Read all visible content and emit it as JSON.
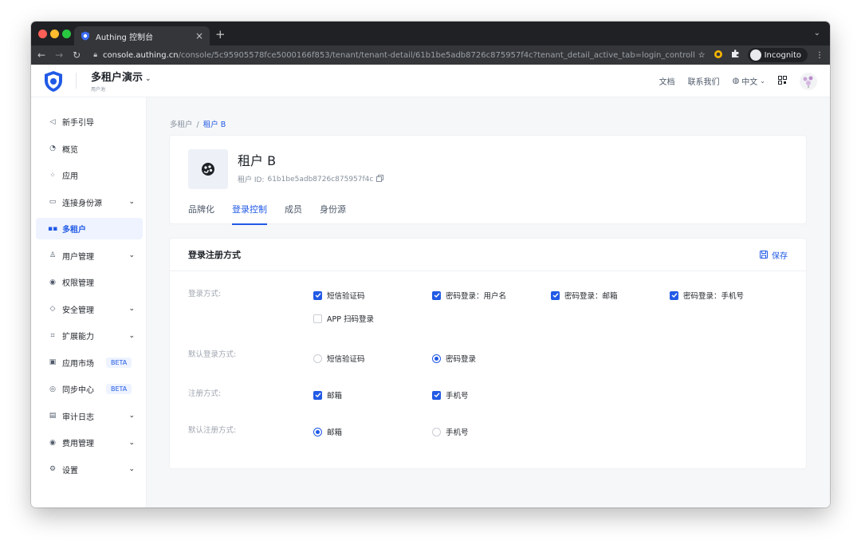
{
  "browser": {
    "tab_title": "Authing 控制台",
    "tab_close": "×",
    "new_tab": "+",
    "url_host": "console.authing.cn",
    "url_path": "/console/5c95905578fce5000166f853/tenant/tenant-detail/61b1be5adb8726c875957f4c?tenant_detail_active_tab=login_controll",
    "incognito_label": "Incognito"
  },
  "header": {
    "org_name": "多租户演示",
    "org_sub": "用户池",
    "links": [
      "文档",
      "联系我们"
    ],
    "language": "中文"
  },
  "sidebar": {
    "items": [
      {
        "label": "新手引导",
        "icon": "send-icon"
      },
      {
        "label": "概览",
        "icon": "dashboard-icon"
      },
      {
        "label": "应用",
        "icon": "apps-icon"
      },
      {
        "label": "连接身份源",
        "icon": "id-card-icon"
      },
      {
        "label": "多租户",
        "icon": "grid-icon"
      },
      {
        "label": "用户管理",
        "icon": "user-icon"
      },
      {
        "label": "权限管理",
        "icon": "target-icon"
      },
      {
        "label": "安全管理",
        "icon": "shield-icon"
      },
      {
        "label": "扩展能力",
        "icon": "extend-icon"
      },
      {
        "label": "应用市场",
        "icon": "store-icon",
        "badge": "BETA"
      },
      {
        "label": "同步中心",
        "icon": "sync-icon",
        "badge": "BETA"
      },
      {
        "label": "审计日志",
        "icon": "log-icon"
      },
      {
        "label": "费用管理",
        "icon": "cost-icon"
      },
      {
        "label": "设置",
        "icon": "settings-icon"
      }
    ]
  },
  "breadcrumb": {
    "parent": "多租户",
    "separator": "/",
    "current": "租户 B"
  },
  "tenant": {
    "name": "租户 B",
    "id_label": "租户 ID:",
    "id_value": "61b1be5adb8726c875957f4c",
    "tabs": [
      "品牌化",
      "登录控制",
      "成员",
      "身份源"
    ],
    "active_tab": "登录控制"
  },
  "login_settings": {
    "title": "登录注册方式",
    "save_label": "保存",
    "login_methods": {
      "label": "登录方式:",
      "options": [
        {
          "label": "短信验证码",
          "checked": true
        },
        {
          "label": "密码登录：用户名",
          "checked": true
        },
        {
          "label": "密码登录：邮箱",
          "checked": true
        },
        {
          "label": "密码登录：手机号",
          "checked": true
        },
        {
          "label": "APP 扫码登录",
          "checked": false
        }
      ]
    },
    "default_login": {
      "label": "默认登录方式:",
      "options": [
        {
          "label": "短信验证码",
          "selected": false
        },
        {
          "label": "密码登录",
          "selected": true
        }
      ]
    },
    "register_methods": {
      "label": "注册方式:",
      "options": [
        {
          "label": "邮箱",
          "checked": true
        },
        {
          "label": "手机号",
          "checked": true
        }
      ]
    },
    "default_register": {
      "label": "默认注册方式:",
      "options": [
        {
          "label": "邮箱",
          "selected": true
        },
        {
          "label": "手机号",
          "selected": false
        }
      ]
    }
  },
  "colors": {
    "accent": "#215ae5",
    "active_bg": "#eef3ff"
  }
}
